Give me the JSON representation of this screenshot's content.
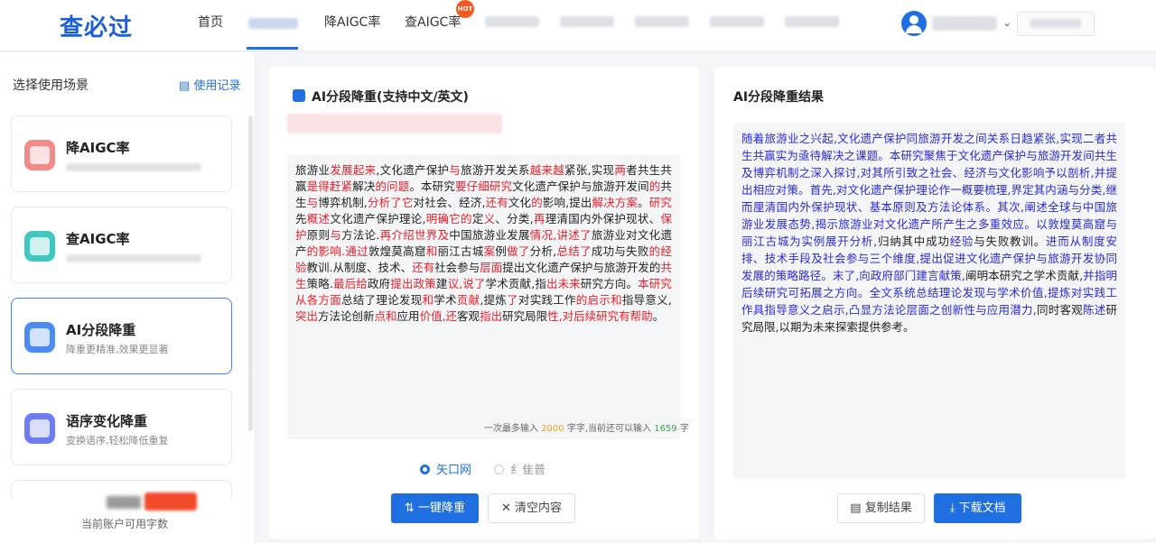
{
  "header": {
    "logo": "查必过",
    "nav": [
      "首页",
      "降AIGC率",
      "查AIGC率"
    ],
    "hot_badge": "HOT"
  },
  "sidebar": {
    "title": "选择使用场景",
    "records_link": "使用记录",
    "cards": [
      {
        "title": "降AIGC率",
        "desc": ""
      },
      {
        "title": "查AIGC率",
        "desc": ""
      },
      {
        "title": "AI分段降重",
        "desc": "降重更精准,效果更显著"
      },
      {
        "title": "语序变化降重",
        "desc": "变换语序,轻松降低重复"
      }
    ],
    "quota_label": "当前账户可用字数"
  },
  "input_panel": {
    "title": "AI分段降重(支持中文/英文)",
    "text_segments": [
      {
        "t": "旅游业",
        "r": false
      },
      {
        "t": "发展起来",
        "r": true
      },
      {
        "t": ",文化遗产保护",
        "r": false
      },
      {
        "t": "与",
        "r": true
      },
      {
        "t": "旅游开发关系",
        "r": false
      },
      {
        "t": "越来越",
        "r": true
      },
      {
        "t": "紧张,实现",
        "r": false
      },
      {
        "t": "两",
        "r": true
      },
      {
        "t": "者共生共赢",
        "r": false
      },
      {
        "t": "是得赶紧",
        "r": true
      },
      {
        "t": "解决",
        "r": false
      },
      {
        "t": "的问题",
        "r": true
      },
      {
        "t": "。本研究",
        "r": false
      },
      {
        "t": "要仔细研究",
        "r": true
      },
      {
        "t": "文化遗产保护与旅游开发间",
        "r": false
      },
      {
        "t": "的",
        "r": true
      },
      {
        "t": "共生",
        "r": false
      },
      {
        "t": "与",
        "r": true
      },
      {
        "t": "博弈机制,",
        "r": false
      },
      {
        "t": "分析了它",
        "r": true
      },
      {
        "t": "对社会、经济,",
        "r": false
      },
      {
        "t": "还有",
        "r": true
      },
      {
        "t": "文化",
        "r": false
      },
      {
        "t": "的",
        "r": true
      },
      {
        "t": "影响,提出",
        "r": false
      },
      {
        "t": "解决方案",
        "r": true
      },
      {
        "t": "。",
        "r": false
      },
      {
        "t": "研究",
        "r": true
      },
      {
        "t": "先",
        "r": false
      },
      {
        "t": "概述",
        "r": true
      },
      {
        "t": "文化遗产保护理论,",
        "r": false
      },
      {
        "t": "明确它的",
        "r": true
      },
      {
        "t": "定",
        "r": false
      },
      {
        "t": "义",
        "r": true
      },
      {
        "t": "、分类,",
        "r": false
      },
      {
        "t": "再",
        "r": true
      },
      {
        "t": "理清国内外保护现状、",
        "r": false
      },
      {
        "t": "保护",
        "r": true
      },
      {
        "t": "原则",
        "r": false
      },
      {
        "t": "与",
        "r": true
      },
      {
        "t": "方法论.",
        "r": false
      },
      {
        "t": "再介绍世界及",
        "r": true
      },
      {
        "t": "中国旅游业发展",
        "r": false
      },
      {
        "t": "情况,讲述了",
        "r": true
      },
      {
        "t": "旅游业对文化遗产",
        "r": false
      },
      {
        "t": "的影响.通过",
        "r": true
      },
      {
        "t": "敦煌莫高窟",
        "r": false
      },
      {
        "t": "和",
        "r": true
      },
      {
        "t": "丽江古城",
        "r": false
      },
      {
        "t": "案",
        "r": true
      },
      {
        "t": "例",
        "r": false
      },
      {
        "t": "做了",
        "r": true
      },
      {
        "t": "分析,",
        "r": false
      },
      {
        "t": "总结了",
        "r": true
      },
      {
        "t": "成功与失败",
        "r": false
      },
      {
        "t": "的经验",
        "r": true
      },
      {
        "t": "教训.从制度、技术、",
        "r": false
      },
      {
        "t": "还有",
        "r": true
      },
      {
        "t": "社会参与",
        "r": false
      },
      {
        "t": "层面",
        "r": true
      },
      {
        "t": "提出文化遗产保护与旅游开发的",
        "r": false
      },
      {
        "t": "共生",
        "r": true
      },
      {
        "t": "策略.",
        "r": false
      },
      {
        "t": "最后给",
        "r": true
      },
      {
        "t": "政府",
        "r": false
      },
      {
        "t": "提出政策",
        "r": true
      },
      {
        "t": "建",
        "r": false
      },
      {
        "t": "议,说了",
        "r": true
      },
      {
        "t": "学术贡献,指",
        "r": false
      },
      {
        "t": "出未来",
        "r": true
      },
      {
        "t": "研究方向。",
        "r": false
      },
      {
        "t": "本研究从各方面",
        "r": true
      },
      {
        "t": "总结了",
        "r": false
      },
      {
        "t": "理论发现",
        "r": false
      },
      {
        "t": "和",
        "r": true
      },
      {
        "t": "学术",
        "r": false
      },
      {
        "t": "贡献",
        "r": true
      },
      {
        "t": ",提炼",
        "r": false
      },
      {
        "t": "了",
        "r": true
      },
      {
        "t": "对实践工作",
        "r": false
      },
      {
        "t": "的启示和",
        "r": true
      },
      {
        "t": "指导意义,",
        "r": false
      },
      {
        "t": "突出",
        "r": true
      },
      {
        "t": "方法论创新",
        "r": false
      },
      {
        "t": "点和",
        "r": true
      },
      {
        "t": "应用",
        "r": false
      },
      {
        "t": "价值,还",
        "r": true
      },
      {
        "t": "客观",
        "r": false
      },
      {
        "t": "指出",
        "r": true
      },
      {
        "t": "研究局限",
        "r": false
      },
      {
        "t": "性,对后续研究有帮助",
        "r": true
      },
      {
        "t": "。",
        "r": false
      }
    ],
    "counter": {
      "prefix": "一次最多输入",
      "max": "2000",
      "mid": "字,当前还可以输入",
      "remain": "1659",
      "suffix": "字"
    },
    "radio_options": [
      {
        "label": "矢口网",
        "checked": true
      },
      {
        "label": "纟隹普",
        "checked": false
      }
    ],
    "primary_button": "一键降重",
    "clear_button": "清空内容"
  },
  "result_panel": {
    "title": "AI分段降重结果",
    "text_segments": [
      {
        "t": "随着旅游业之兴起,文化遗产保护同旅游开发之间关系日趋紧张,实现二者共生共赢实为亟待解决之课题。本研究聚焦于文化遗产保护与旅游开发间共生及博弈机制之深入探讨,对其所引致之社会、经济与文化影响予以剖析,并提出相应对策。首先,对文化遗产保护理论作一概要梳理,界定其内涵与分类,继而厘清国内外保护现状、基本原则及方法论体系。其次,阐述全球与中国旅游业发展态势,揭示旅游业对文化遗产所产生之多重效应。以敦煌莫高窟与丽江古城为实例展开分析,",
        "k": false
      },
      {
        "t": "归纳其中成功",
        "k": true
      },
      {
        "t": "经验",
        "k": false
      },
      {
        "t": "与失败教训。",
        "k": true
      },
      {
        "t": "进而从制度安排、技术手段及社会参与三个维度,提出促进文化遗产保护与旅游开发协同发展的策略路径。末了,向政府部门建言献策,",
        "k": false
      },
      {
        "t": "阐明本研究之学术贡献,",
        "k": true
      },
      {
        "t": "并指明后续研究可拓展之方向。全文系统总结理论发现与学术价值,提炼对实践工作具指导意义之启示,凸显方法论层面之创新性与应用潜力,",
        "k": false
      },
      {
        "t": "同时客观",
        "k": true
      },
      {
        "t": "陈述",
        "k": false
      },
      {
        "t": "研究局限,以期为未来探索提供参考。",
        "k": true
      }
    ],
    "copy_button": "复制结果",
    "download_button": "下载文档"
  },
  "colors": {
    "accent": "#1f6fe0",
    "highlight_red": "#e8202a",
    "result_blue": "#2a2ad8"
  }
}
